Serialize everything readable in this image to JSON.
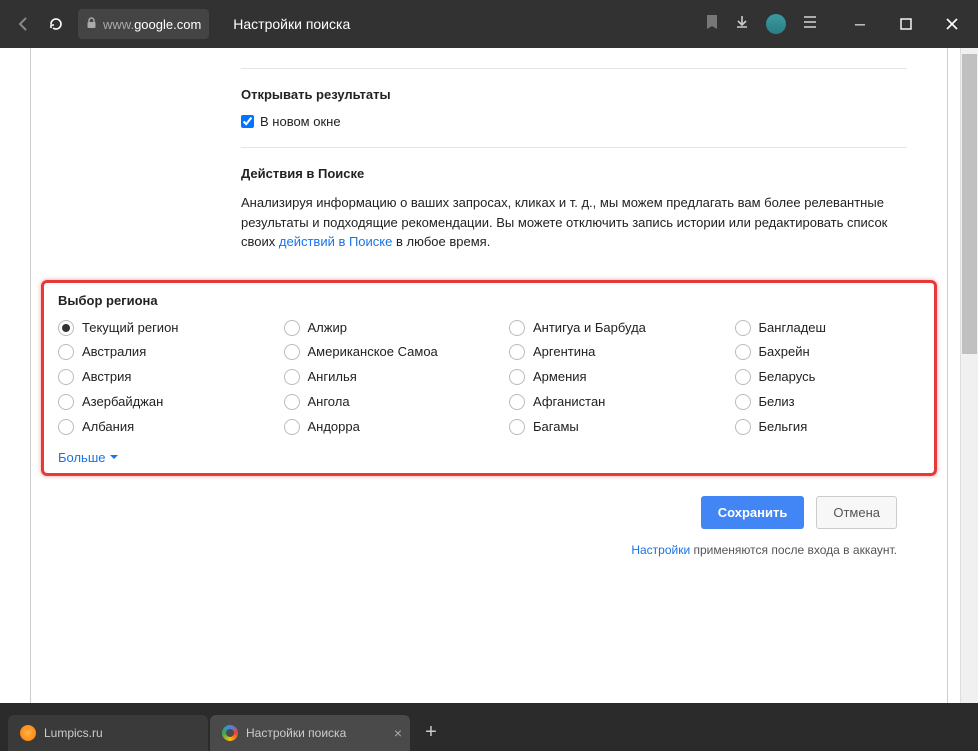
{
  "titlebar": {
    "url_prefix": "www.",
    "url_domain": "google.com",
    "page_title": "Настройки поиска"
  },
  "sections": {
    "open_results": {
      "heading": "Открывать результаты",
      "checkbox_label": "В новом окне"
    },
    "search_actions": {
      "heading": "Действия в Поиске",
      "body_pre": "Анализируя информацию о ваших запросах, кликах и т. д., мы можем предлагать вам более релевантные результаты и подходящие рекомендации. Вы можете отключить запись истории или редактировать список своих ",
      "link": "действий в Поиске",
      "body_post": " в любое время."
    },
    "region": {
      "heading": "Выбор региона",
      "columns": [
        [
          {
            "label": "Текущий регион",
            "selected": true
          },
          {
            "label": "Австралия"
          },
          {
            "label": "Австрия"
          },
          {
            "label": "Азербайджан"
          },
          {
            "label": "Албания"
          }
        ],
        [
          {
            "label": "Алжир"
          },
          {
            "label": "Американское Самоа"
          },
          {
            "label": "Ангилья"
          },
          {
            "label": "Ангола"
          },
          {
            "label": "Андорра"
          }
        ],
        [
          {
            "label": "Антигуа и Барбуда"
          },
          {
            "label": "Аргентина"
          },
          {
            "label": "Армения"
          },
          {
            "label": "Афганистан"
          },
          {
            "label": "Багамы"
          }
        ],
        [
          {
            "label": "Бангладеш"
          },
          {
            "label": "Бахрейн"
          },
          {
            "label": "Беларусь"
          },
          {
            "label": "Белиз"
          },
          {
            "label": "Бельгия"
          }
        ]
      ],
      "more": "Больше"
    }
  },
  "actions": {
    "save": "Сохранить",
    "cancel": "Отмена"
  },
  "footer": {
    "link": "Настройки",
    "text": " применяются после входа в аккаунт."
  },
  "tabs": {
    "tab1": "Lumpics.ru",
    "tab2": "Настройки поиска"
  }
}
